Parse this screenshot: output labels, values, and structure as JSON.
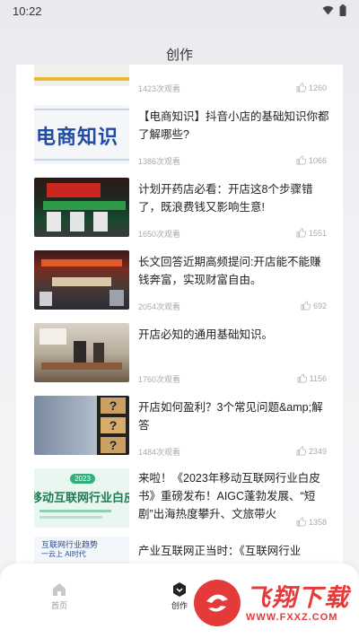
{
  "status": {
    "time": "10:22"
  },
  "header": {
    "title": "创作"
  },
  "articles": [
    {
      "title": "",
      "views": "1423次观看",
      "likes": "1260"
    },
    {
      "title": "【电商知识】抖音小店的基础知识你都了解哪些?",
      "views": "1386次观看",
      "likes": "1066",
      "thumb_text": "电商知识"
    },
    {
      "title": "计划开药店必看：开店这8个步骤错了，既浪费钱又影响生意!",
      "views": "1650次观看",
      "likes": "1551"
    },
    {
      "title": "长文回答近期高频提问:开店能不能赚钱奔富，实现财富自由。",
      "views": "2054次观看",
      "likes": "692"
    },
    {
      "title": "开店必知的通用基础知识。",
      "views": "1760次观看",
      "likes": "1156"
    },
    {
      "title": "开店如何盈利？3个常见问题&amp;解答",
      "views": "1484次观看",
      "likes": "2349"
    },
    {
      "title": "来啦！《2023年移动互联网行业白皮书》重磅发布！AIGC蓬勃发展、“短剧”出海热度攀升、文旅带火",
      "views": "",
      "likes": "1358",
      "thumb_text": "移动互联网行业白皮书",
      "thumb_year": "2023"
    },
    {
      "title": "产业互联网正当时：《互联网行业",
      "thumb_text": "互联网行业趋势",
      "thumb_sub": "一云上 AI时代"
    }
  ],
  "tabbar": {
    "home_label": "首页",
    "create_label": "创作"
  },
  "watermark": {
    "text": "飞翔下载",
    "url": "WWW.FXXZ.COM"
  }
}
